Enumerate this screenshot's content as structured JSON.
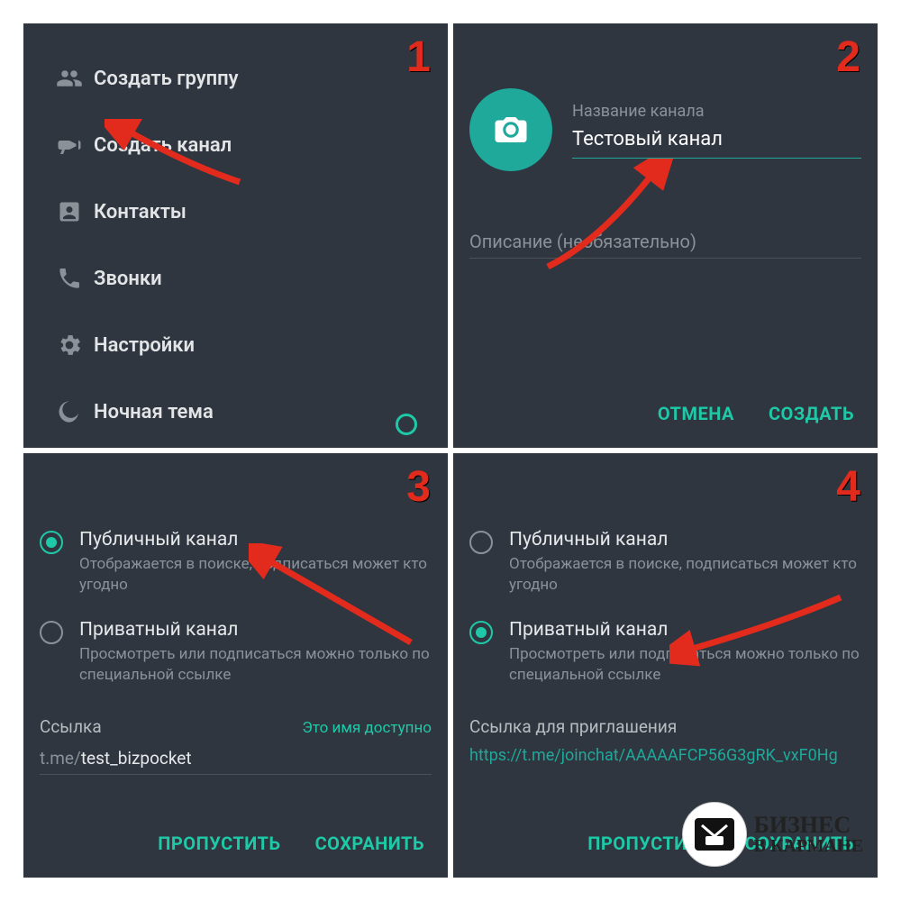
{
  "steps": [
    "1",
    "2",
    "3",
    "4"
  ],
  "panel1": {
    "items": [
      {
        "label": "Создать группу",
        "icon": "group-icon"
      },
      {
        "label": "Создать канал",
        "icon": "megaphone-icon"
      },
      {
        "label": "Контакты",
        "icon": "contact-icon"
      },
      {
        "label": "Звонки",
        "icon": "phone-icon"
      },
      {
        "label": "Настройки",
        "icon": "gear-icon"
      },
      {
        "label": "Ночная тема",
        "icon": "moon-icon"
      }
    ],
    "night_mode_on": true
  },
  "panel2": {
    "name_label": "Название канала",
    "name_value": "Тестовый канал",
    "desc_placeholder": "Описание (необязательно)",
    "cancel": "ОТМЕНА",
    "create": "СОЗДАТЬ"
  },
  "panel3": {
    "options": [
      {
        "title": "Публичный канал",
        "desc": "Отображается в поиске, подписаться может кто угодно",
        "selected": true
      },
      {
        "title": "Приватный канал",
        "desc": "Просмотреть или подписаться можно только по специальной ссылке",
        "selected": false
      }
    ],
    "link_label": "Ссылка",
    "link_ok": "Это имя доступно",
    "link_prefix": "t.me/",
    "link_value": "test_bizpocket",
    "skip": "ПРОПУСТИТЬ",
    "save": "СОХРАНИТЬ"
  },
  "panel4": {
    "options": [
      {
        "title": "Публичный канал",
        "desc": "Отображается в поиске, подписаться может кто угодно",
        "selected": false
      },
      {
        "title": "Приватный канал",
        "desc": "Просмотреть или подписаться можно только по специальной ссылке",
        "selected": true
      }
    ],
    "invite_label": "Ссылка для приглашения",
    "invite_link": "https://t.me/joinchat/AAAAAFCP56G3gRK_vxF0Hg",
    "skip": "ПРОПУСТИТЬ",
    "save": "СОХРАНИТЬ"
  },
  "watermark": {
    "line1": "БИЗНЕС",
    "line2": "В КАРМАНЕ"
  },
  "colors": {
    "accent": "#1ec9a7",
    "panel": "#2f3640",
    "muted": "#8a9199",
    "step": "#e22b1c"
  }
}
